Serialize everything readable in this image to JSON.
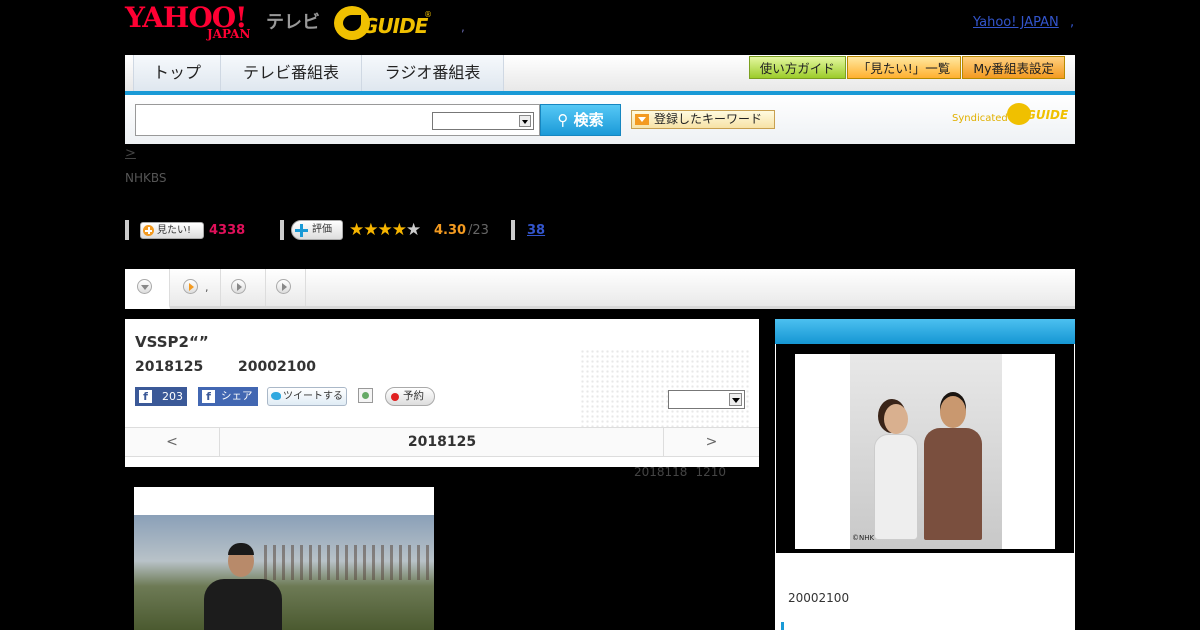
{
  "header": {
    "yahoo_logo": "YAHOO!",
    "yahoo_logo_sub": "JAPAN",
    "tv_label": "テレビ",
    "gguide_logo": "GUIDE",
    "gguide_mark": "®",
    "comma": ",",
    "yahoo_japan_link": "Yahoo! JAPAN",
    "trailing_dot": ","
  },
  "nav": {
    "tabs": [
      {
        "label": "トップ"
      },
      {
        "label": "テレビ番組表"
      },
      {
        "label": "ラジオ番組表"
      }
    ],
    "buttons": [
      {
        "label": "使い方ガイド"
      },
      {
        "label": "「見たい!」一覧"
      },
      {
        "label": "My番組表設定"
      }
    ]
  },
  "search": {
    "input_value": "",
    "select_value": "",
    "button_label": "検索",
    "keyword_button": "登録したキーワード",
    "syndicated": "Syndicated",
    "syndicated_logo": "GUIDE"
  },
  "breadcrumb": {
    "text": ">"
  },
  "channel": "NHKBS",
  "stats": {
    "mitai_label": "見たい!",
    "mitai_count": "4338",
    "hyoka_label": "評価",
    "stars_full": 4,
    "stars_total": 5,
    "rating": "4.30",
    "rating_denominator": "/23",
    "review_count": "38"
  },
  "tabs_row": [
    {
      "icon": "circle-down-icon",
      "label": ""
    },
    {
      "icon": "circle-play-orange-icon",
      "label": ","
    },
    {
      "icon": "circle-play-icon",
      "label": ""
    },
    {
      "icon": "circle-play-icon",
      "label": ""
    }
  ],
  "program": {
    "title": "VSSP2“”",
    "date": "2018125",
    "time": "20002100",
    "fb_count": "203",
    "fb_share": "シェア",
    "tweet": "ツイートする",
    "reserve": "予約",
    "select_value": ""
  },
  "pager": {
    "prev": "<",
    "current": "2018125",
    "next": ">"
  },
  "updated": {
    "date": "2018118",
    "time": "1210"
  },
  "sidebar": {
    "header": "",
    "photo_credit": "©NHK",
    "time": "20002100"
  },
  "colors": {
    "accent_blue": "#1a9ad6",
    "mitai_pink": "#e0105a",
    "rating_orange": "#f39a20",
    "star_gold": "#f7b500",
    "yahoo_red": "#ff0033"
  }
}
